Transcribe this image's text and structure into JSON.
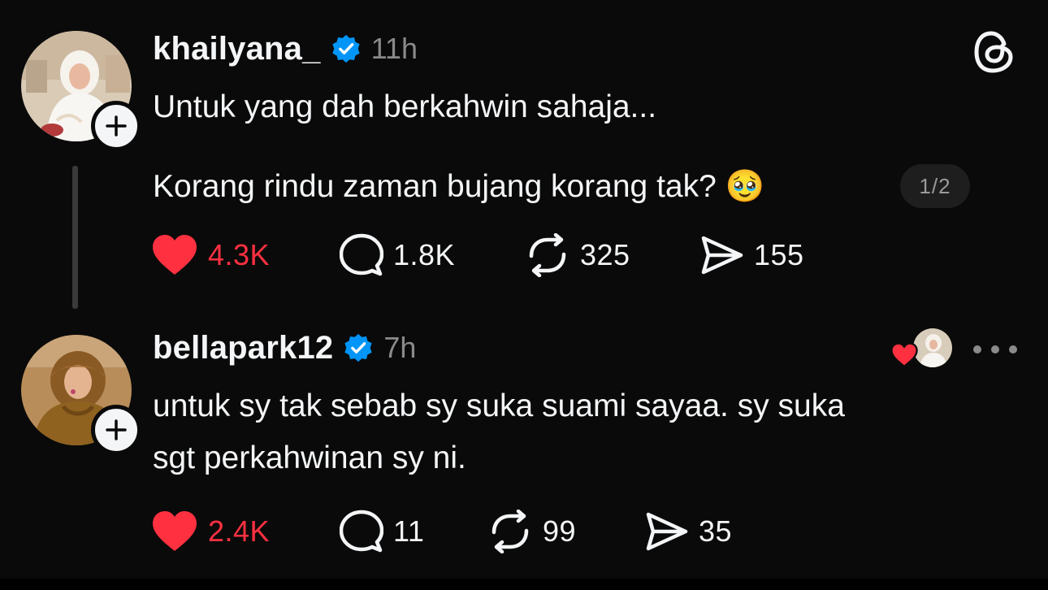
{
  "colors": {
    "background": "#0a0a0a",
    "text": "#f3f5f7",
    "muted": "#8a8a8a",
    "like_red": "#ff3040",
    "verified_blue": "#0095f6"
  },
  "posts": [
    {
      "username": "khailyana_",
      "verified": true,
      "timestamp": "11h",
      "lines": [
        "Untuk yang dah berkahwin sahaja...",
        "Korang rindu zaman bujang korang tak? 🥹"
      ],
      "page_indicator": "1/2",
      "likes": "4.3K",
      "liked": true,
      "replies": "1.8K",
      "reposts": "325",
      "shares": "155"
    },
    {
      "username": "bellapark12",
      "verified": true,
      "timestamp": "7h",
      "lines": [
        "untuk sy tak sebab sy suka suami sayaa. sy suka",
        "sgt perkahwinan sy ni."
      ],
      "likes": "2.4K",
      "liked": true,
      "replies": "11",
      "reposts": "99",
      "shares": "35"
    }
  ],
  "icons": {
    "app_logo": "threads-logo-icon",
    "follow": "plus-icon",
    "verified": "verified-badge-icon",
    "like": "heart-icon",
    "reply": "comment-bubble-icon",
    "repost": "repost-icon",
    "share": "send-icon",
    "more": "more-horizontal-icon"
  }
}
